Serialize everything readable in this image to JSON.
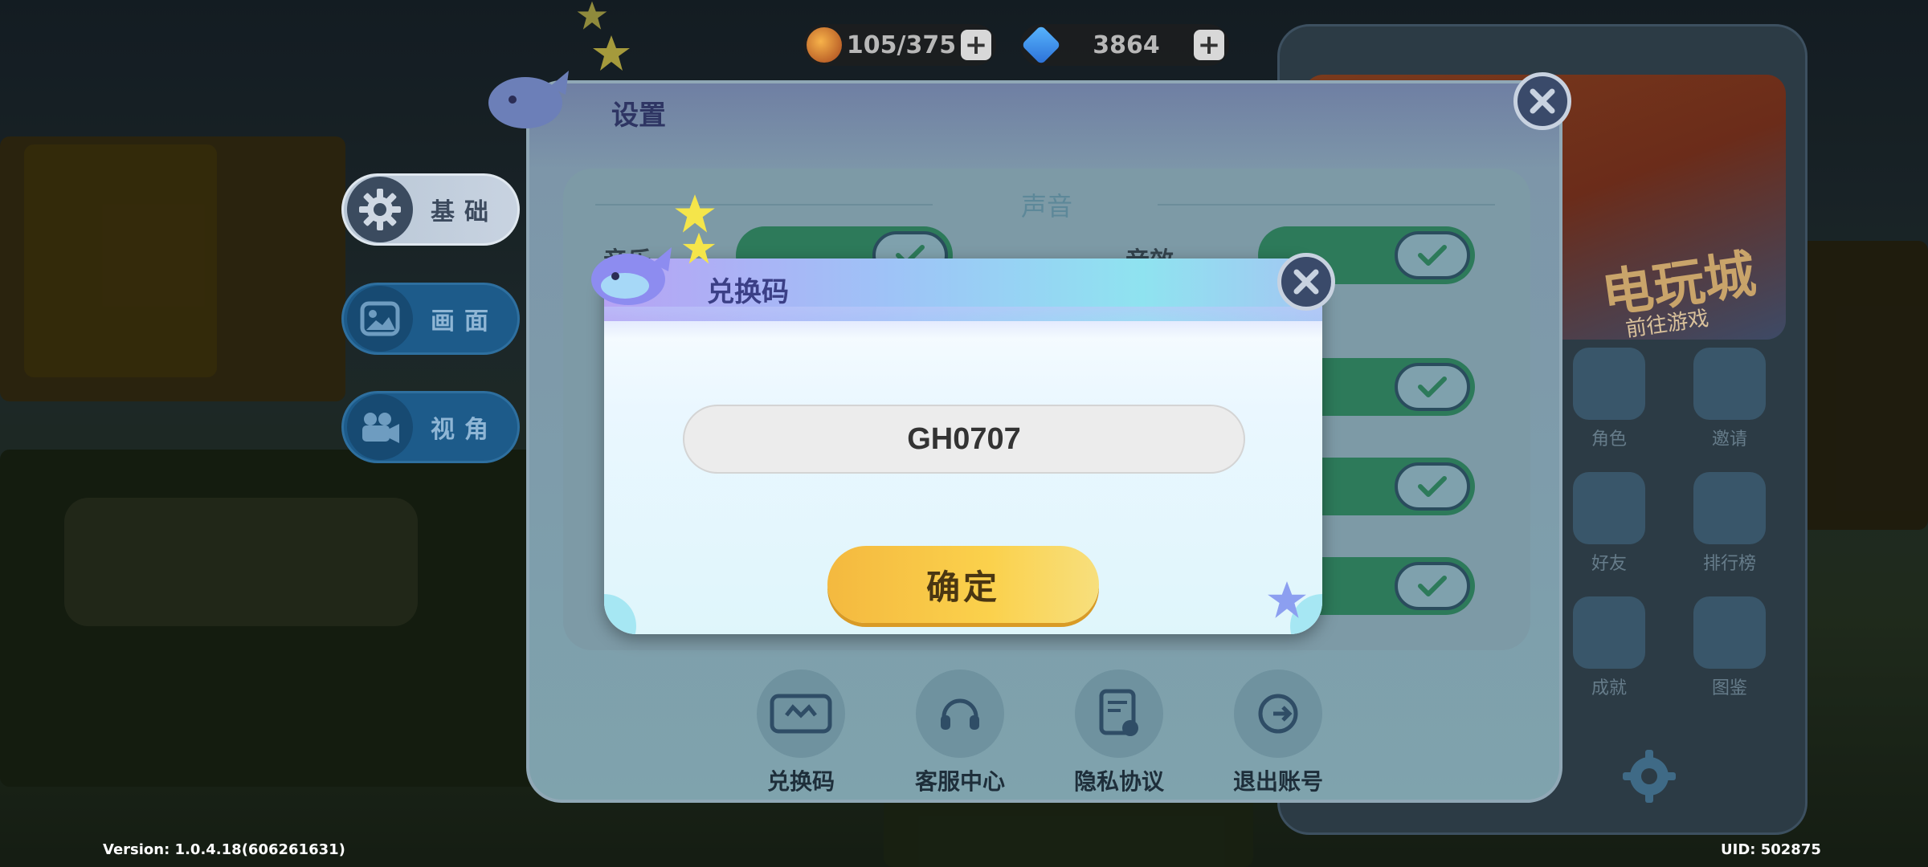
{
  "resources": {
    "stamina": "105/375",
    "gems": "3864"
  },
  "side_tabs": [
    {
      "label": "基础",
      "icon": "gear-icon",
      "active": true
    },
    {
      "label": "画面",
      "icon": "picture-icon",
      "active": false
    },
    {
      "label": "视角",
      "icon": "camera-icon",
      "active": false
    }
  ],
  "settings": {
    "title": "设置",
    "section_heading": "声音",
    "options": [
      {
        "label": "音乐",
        "on": true
      },
      {
        "label": "音效",
        "on": true
      }
    ],
    "bottom_actions": [
      {
        "label": "兑换码",
        "icon": "ticket-icon"
      },
      {
        "label": "客服中心",
        "icon": "headset-icon"
      },
      {
        "label": "隐私协议",
        "icon": "document-icon"
      },
      {
        "label": "退出账号",
        "icon": "logout-icon"
      }
    ]
  },
  "redeem_dialog": {
    "title": "兑换码",
    "code_value": "GH0707",
    "confirm_label": "确定"
  },
  "hub": {
    "banner_title": "电玩城",
    "banner_sub": "前往游戏",
    "tiles": [
      "角色",
      "邀请",
      "好友",
      "排行榜",
      "成就",
      "图鉴"
    ]
  },
  "footer": {
    "version": "Version: 1.0.4.18(606261631)",
    "uid": "UID: 502875"
  },
  "colors": {
    "accent_confirm": "#fbd14c",
    "dialog_header": "#8fe3f0",
    "toggle_on": "#2d7a5a"
  }
}
